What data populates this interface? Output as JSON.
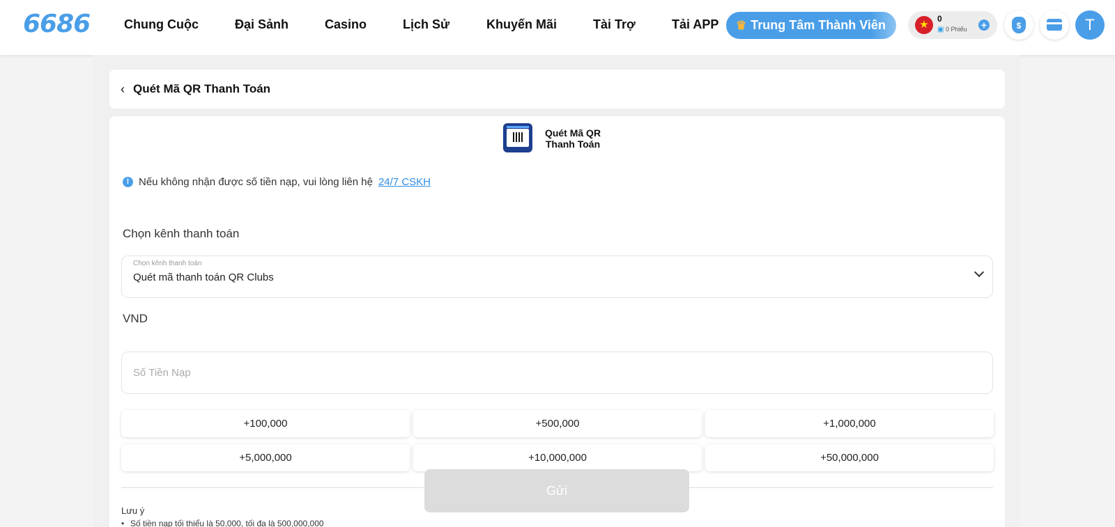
{
  "header": {
    "logo": "6686",
    "nav": [
      "Chung Cuộc",
      "Đại Sảnh",
      "Casino",
      "Lịch Sử",
      "Khuyến Mãi",
      "Tài Trợ",
      "Tải APP"
    ],
    "member_center": "Trung Tâm Thành Viên",
    "balance": "0",
    "tickets": "0 Phiếu",
    "avatar_letter": "T"
  },
  "page": {
    "title": "Quét Mã QR Thanh Toán",
    "method_label": "Quét Mã QR Thanh Toán"
  },
  "form": {
    "notice_text": "Nếu không nhận được số tiền nạp, vui lòng liên hệ",
    "notice_link": "24/7 CSKH",
    "channel_label": "Chọn kênh thanh toán",
    "channel_caption": "Chọn kênh thanh toán",
    "channel_value": "Quét mã thanh toán QR Clubs",
    "currency": "VND",
    "amount_placeholder": "Số Tiền Nạp",
    "chips": [
      "+100,000",
      "+500,000",
      "+1,000,000",
      "+5,000,000",
      "+10,000,000",
      "+50,000,000"
    ],
    "submit": "Gửi",
    "note_title": "Lưu ý",
    "note_item": "Số tiền nạp tối thiểu là 50,000, tối đa là 500,000,000"
  },
  "icons": {
    "back": "chevron-left-icon",
    "info": "info-icon",
    "dropdown": "chevron-down-icon",
    "flag": "vietnam-flag-icon",
    "ticket": "ticket-icon",
    "add": "plus-icon",
    "wallet": "money-bag-icon",
    "card": "card-icon",
    "crown": "crown-icon"
  },
  "colors": {
    "accent": "#4a9ee8",
    "submit_disabled": "#dcdcdc"
  }
}
